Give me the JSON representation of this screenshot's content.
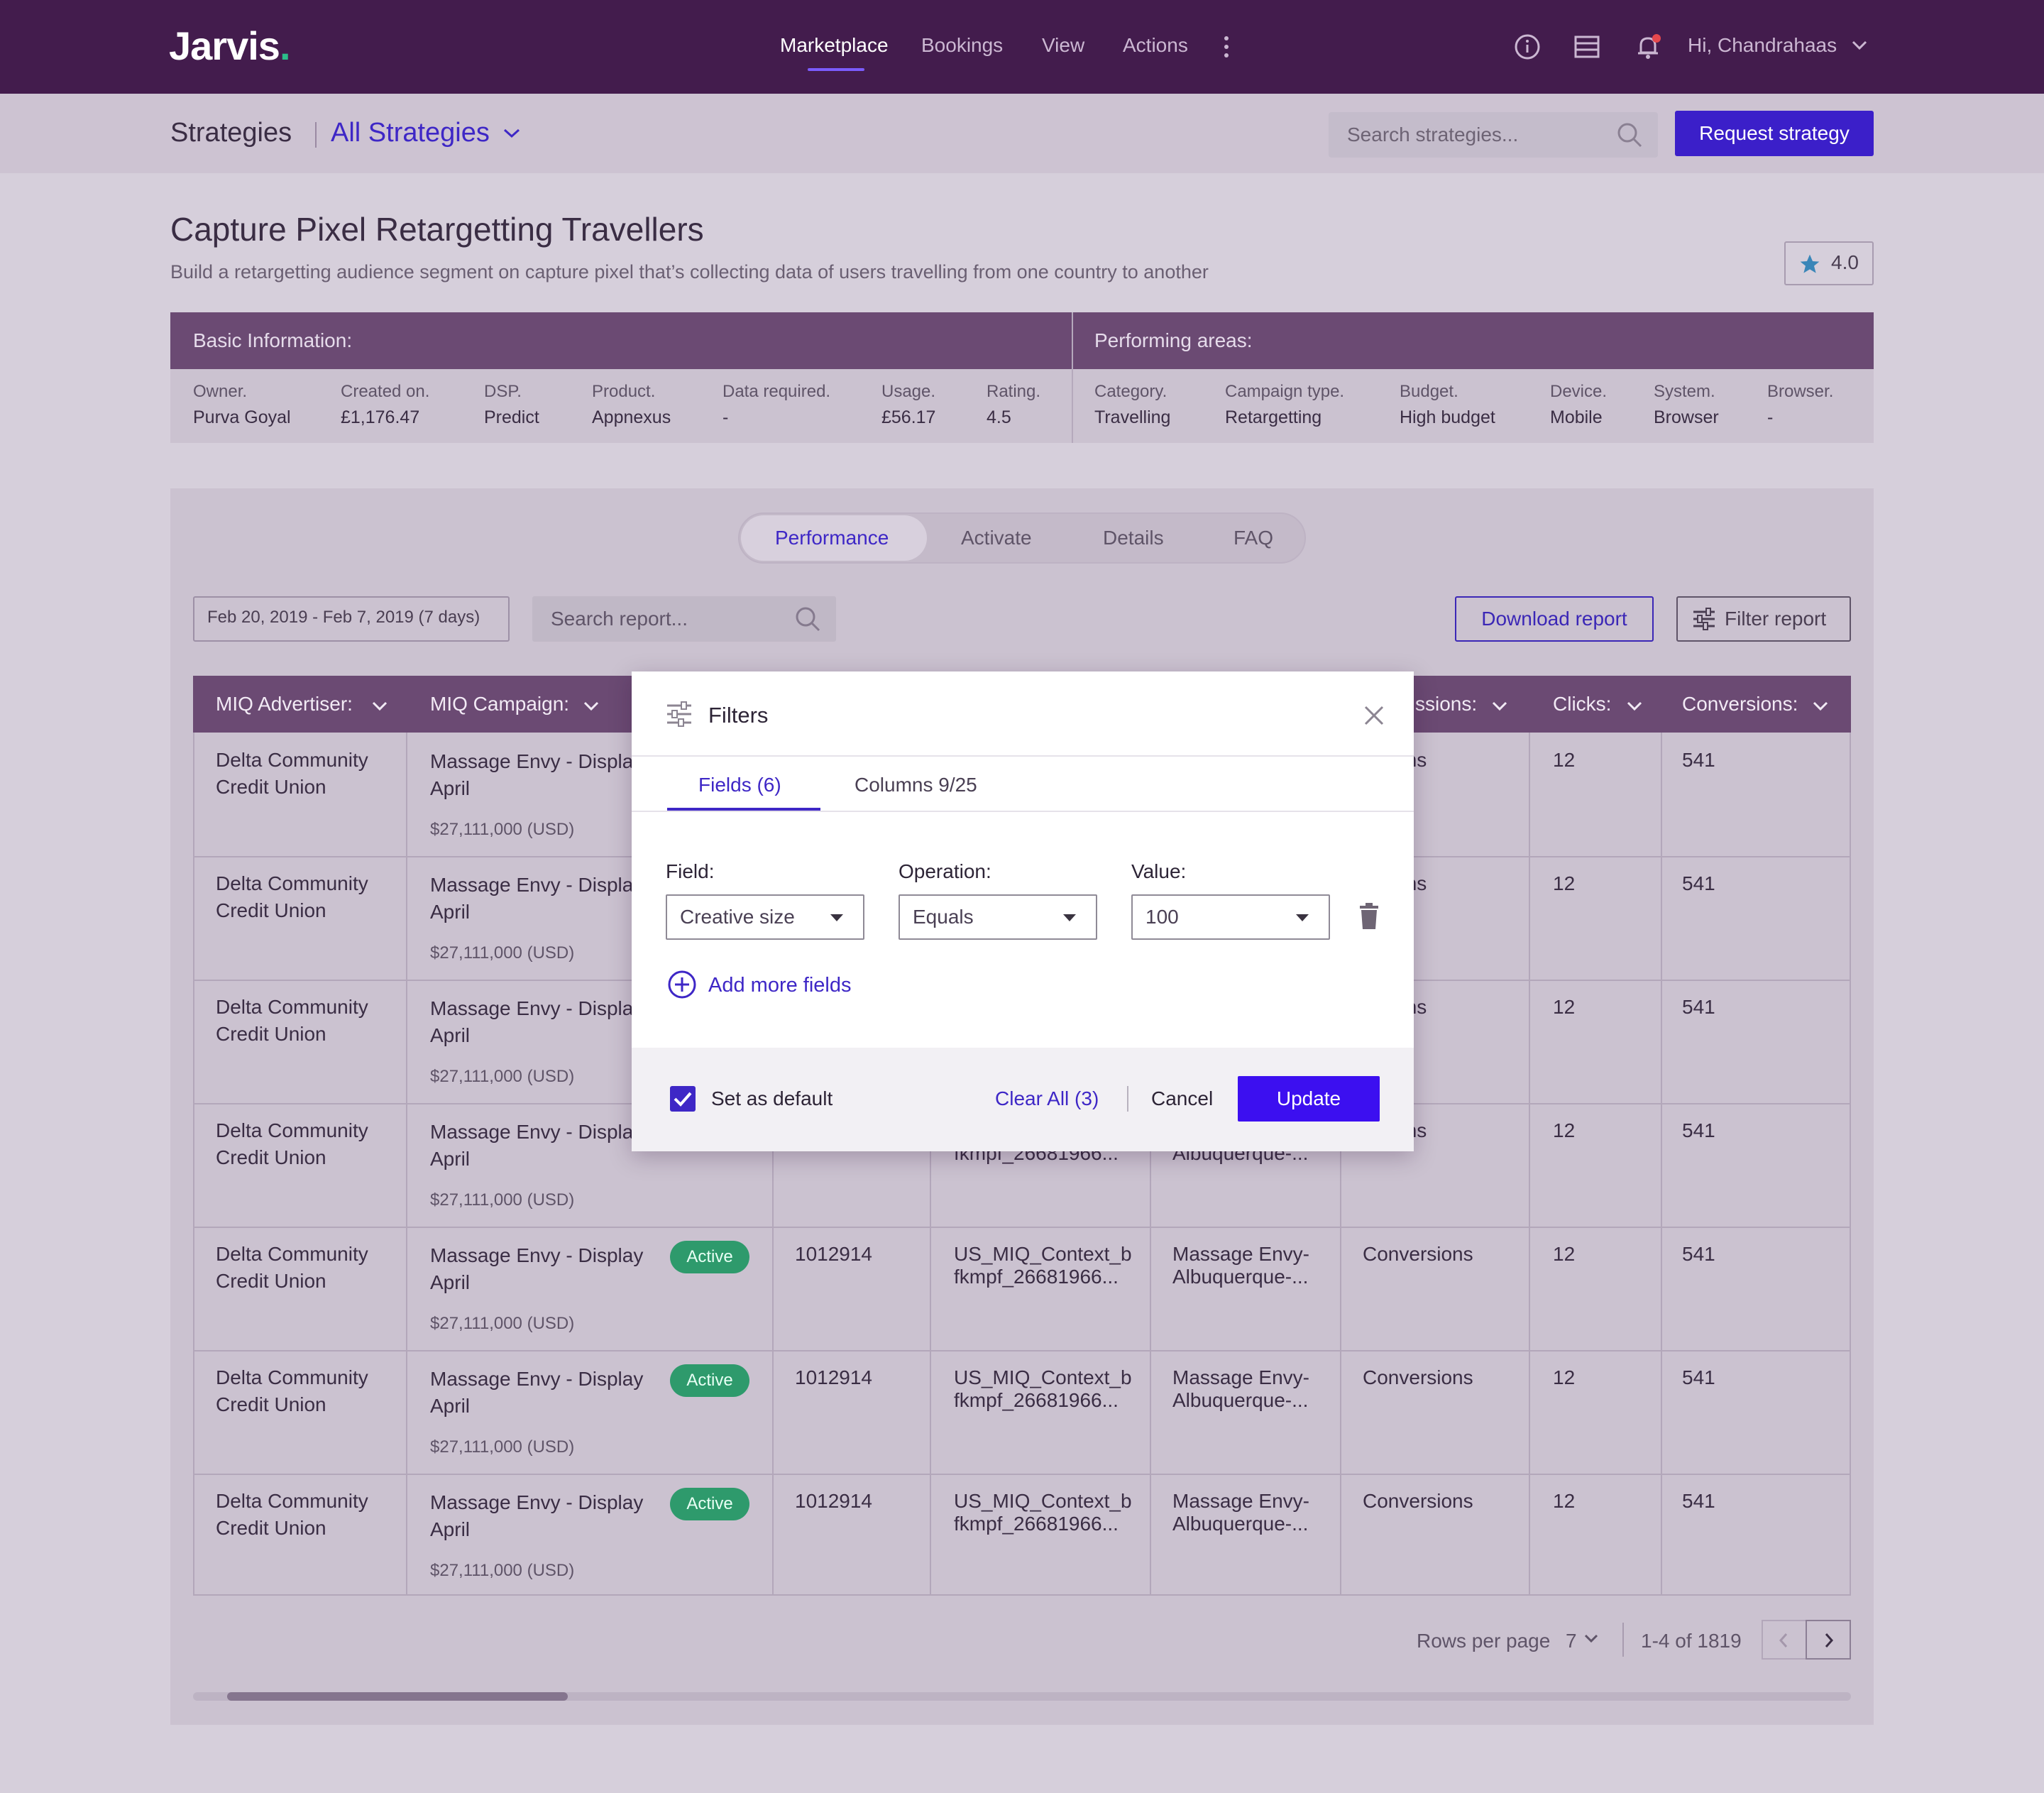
{
  "nav": {
    "brand": "Jarvis",
    "brand_dot": ".",
    "links": [
      "Marketplace",
      "Bookings",
      "View",
      "Actions"
    ],
    "greeting": "Hi, Chandrahaas",
    "icons": [
      "info-icon",
      "table-icon",
      "bell-icon"
    ],
    "notification_dot_color": "#e5484d"
  },
  "subheader": {
    "title": "Strategies",
    "selector": "All Strategies",
    "search_placeholder": "Search strategies...",
    "request_button": "Request strategy"
  },
  "strategy": {
    "title": "Capture Pixel Retargetting Travellers",
    "description": "Build a retargetting audience segment on capture pixel that’s collecting data of users travelling from one country to another",
    "rating": "4.0"
  },
  "basic_info": {
    "heading": "Basic Information:",
    "fields": [
      {
        "label": "Owner.",
        "value": "Purva Goyal"
      },
      {
        "label": "Created on.",
        "value": "£1,176.47"
      },
      {
        "label": "DSP.",
        "value": "Predict"
      },
      {
        "label": "Product.",
        "value": "Appnexus"
      },
      {
        "label": "Data required.",
        "value": "-"
      },
      {
        "label": "Usage.",
        "value": "£56.17"
      },
      {
        "label": "Rating.",
        "value": "4.5"
      }
    ]
  },
  "performing_areas": {
    "heading": "Performing areas:",
    "fields": [
      {
        "label": "Category.",
        "value": "Travelling"
      },
      {
        "label": "Campaign type.",
        "value": "Retargetting"
      },
      {
        "label": "Budget.",
        "value": "High budget"
      },
      {
        "label": "Device.",
        "value": "Mobile"
      },
      {
        "label": "System.",
        "value": "Browser"
      },
      {
        "label": "Browser.",
        "value": "-"
      }
    ]
  },
  "tabs": [
    "Performance",
    "Activate",
    "Details",
    "FAQ"
  ],
  "active_tab": "Performance",
  "report": {
    "date_range": "Feb 20, 2019 - Feb 7, 2019 (7 days)",
    "search_placeholder": "Search report...",
    "download_button": "Download report",
    "filter_button": "Filter report"
  },
  "table": {
    "headers": [
      "MIQ Advertiser:",
      "MIQ Campaign:",
      "ssions:",
      "Clicks:",
      "Conversions:"
    ],
    "rows": [
      {
        "advertiser": [
          "Delta Community",
          "Credit Union"
        ],
        "campaign": [
          "Massage Envy - Displa",
          "April"
        ],
        "budget": "$27,111,000 (USD)",
        "status": "",
        "id": "",
        "line": [
          "",
          ""
        ],
        "creative": [
          "",
          ""
        ],
        "goal": "ersions",
        "clicks": "12",
        "conversions": "541"
      },
      {
        "advertiser": [
          "Delta Community",
          "Credit Union"
        ],
        "campaign": [
          "Massage Envy - Displa",
          "April"
        ],
        "budget": "$27,111,000 (USD)",
        "status": "",
        "id": "",
        "line": [
          "",
          ""
        ],
        "creative": [
          "",
          ""
        ],
        "goal": "ersions",
        "clicks": "12",
        "conversions": "541"
      },
      {
        "advertiser": [
          "Delta Community",
          "Credit Union"
        ],
        "campaign": [
          "Massage Envy - Displa",
          "April"
        ],
        "budget": "$27,111,000 (USD)",
        "status": "",
        "id": "",
        "line": [
          "",
          ""
        ],
        "creative": [
          "",
          ""
        ],
        "goal": "ersions",
        "clicks": "12",
        "conversions": "541"
      },
      {
        "advertiser": [
          "Delta Community",
          "Credit Union"
        ],
        "campaign": [
          "Massage Envy - Displa",
          "April"
        ],
        "budget": "$27,111,000 (USD)",
        "status": "",
        "id": "",
        "line": [
          "",
          "fkmpf_26681966..."
        ],
        "creative": [
          "",
          "Albuquerque-..."
        ],
        "goal": "ersions",
        "clicks": "12",
        "conversions": "541"
      },
      {
        "advertiser": [
          "Delta Community",
          "Credit Union"
        ],
        "campaign": [
          "Massage Envy - Display",
          "April"
        ],
        "budget": "$27,111,000 (USD)",
        "status": "Active",
        "id": "1012914",
        "line": [
          "US_MIQ_Context_b",
          "fkmpf_26681966..."
        ],
        "creative": [
          "Massage Envy-",
          "Albuquerque-..."
        ],
        "goal": "Conversions",
        "clicks": "12",
        "conversions": "541"
      },
      {
        "advertiser": [
          "Delta Community",
          "Credit Union"
        ],
        "campaign": [
          "Massage Envy - Display",
          "April"
        ],
        "budget": "$27,111,000 (USD)",
        "status": "Active",
        "id": "1012914",
        "line": [
          "US_MIQ_Context_b",
          "fkmpf_26681966..."
        ],
        "creative": [
          "Massage Envy-",
          "Albuquerque-..."
        ],
        "goal": "Conversions",
        "clicks": "12",
        "conversions": "541"
      },
      {
        "advertiser": [
          "Delta Community",
          "Credit Union"
        ],
        "campaign": [
          "Massage Envy - Display",
          "April"
        ],
        "budget": "$27,111,000 (USD)",
        "status": "Active",
        "id": "1012914",
        "line": [
          "US_MIQ_Context_b",
          "fkmpf_26681966..."
        ],
        "creative": [
          "Massage Envy-",
          "Albuquerque-..."
        ],
        "goal": "Conversions",
        "clicks": "12",
        "conversions": "541"
      }
    ]
  },
  "pagination": {
    "rows_label": "Rows per page",
    "rows_value": "7",
    "range": "1-4 of 1819"
  },
  "modal": {
    "title": "Filters",
    "tabs": [
      "Fields (6)",
      "Columns 9/25"
    ],
    "field_label": "Field:",
    "operation_label": "Operation:",
    "value_label": "Value:",
    "field_value": "Creative size",
    "operation_value": "Equals",
    "value_value": "100",
    "add_more": "Add more fields",
    "set_default": "Set as default",
    "clear_all": "Clear All (3)",
    "cancel": "Cancel",
    "update": "Update"
  },
  "colors": {
    "nav_bg": "#431c4d",
    "accent": "#3e27c6",
    "active_badge": "#2e9a6c",
    "header_band": "#6b4a73"
  }
}
